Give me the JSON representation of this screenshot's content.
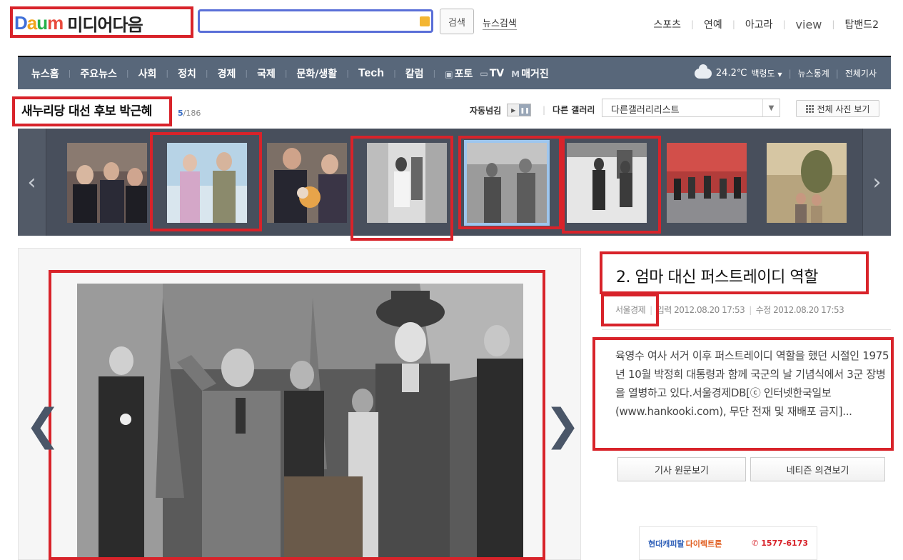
{
  "header": {
    "logo_daum": "Daum",
    "logo_text": "미디어다음",
    "search_button": "검색",
    "news_search": "뉴스검색",
    "top_nav": [
      "스포츠",
      "연예",
      "아고라",
      "view",
      "탑밴드2"
    ]
  },
  "gnb": {
    "items": [
      "뉴스홈",
      "주요뉴스",
      "사회",
      "정치",
      "경제",
      "국제",
      "문화/생활",
      "Tech",
      "칼럼"
    ],
    "media": [
      {
        "icon": "photo-icon",
        "label": "포토"
      },
      {
        "icon": "tv-icon",
        "label": "TV"
      },
      {
        "icon": "magazine-icon",
        "label": "매거진"
      }
    ],
    "weather_temp": "24.2℃",
    "weather_place": "백령도",
    "news_stats": "뉴스통계",
    "all_articles": "전체기사"
  },
  "gallery": {
    "title": "새누리당 대선 후보 박근혜",
    "current": "5",
    "total": "/186",
    "autoplay_label": "자동넘김",
    "other_gallery_label": "다른 갤러리",
    "other_gallery_select": "다른갤러리리스트",
    "all_photos_button": "전체 사진 보기"
  },
  "article": {
    "title": "2. 엄마 대신 퍼스트레이디 역할",
    "source": "서울경제",
    "input_date": "입력 2012.08.20 17:53",
    "edit_date": "수정 2012.08.20 17:53",
    "body": "육영수 여사 서거 이후 퍼스트레이디 역할을 했던 시절인 1975년 10월 박정희 대통령과 함께 국군의 날 기념식에서 3군 장병을 열병하고 있다.서울경제DB[ⓒ 인터넷한국일보(www.hankooki.com), 무단 전재 및 재배포 금지]...",
    "view_original_button": "기사 원문보기",
    "comments_button": "네티즌 의견보기"
  },
  "ad": {
    "brand": "현대캐피탈",
    "product": "다이렉트론",
    "phone": "1577-6173"
  }
}
